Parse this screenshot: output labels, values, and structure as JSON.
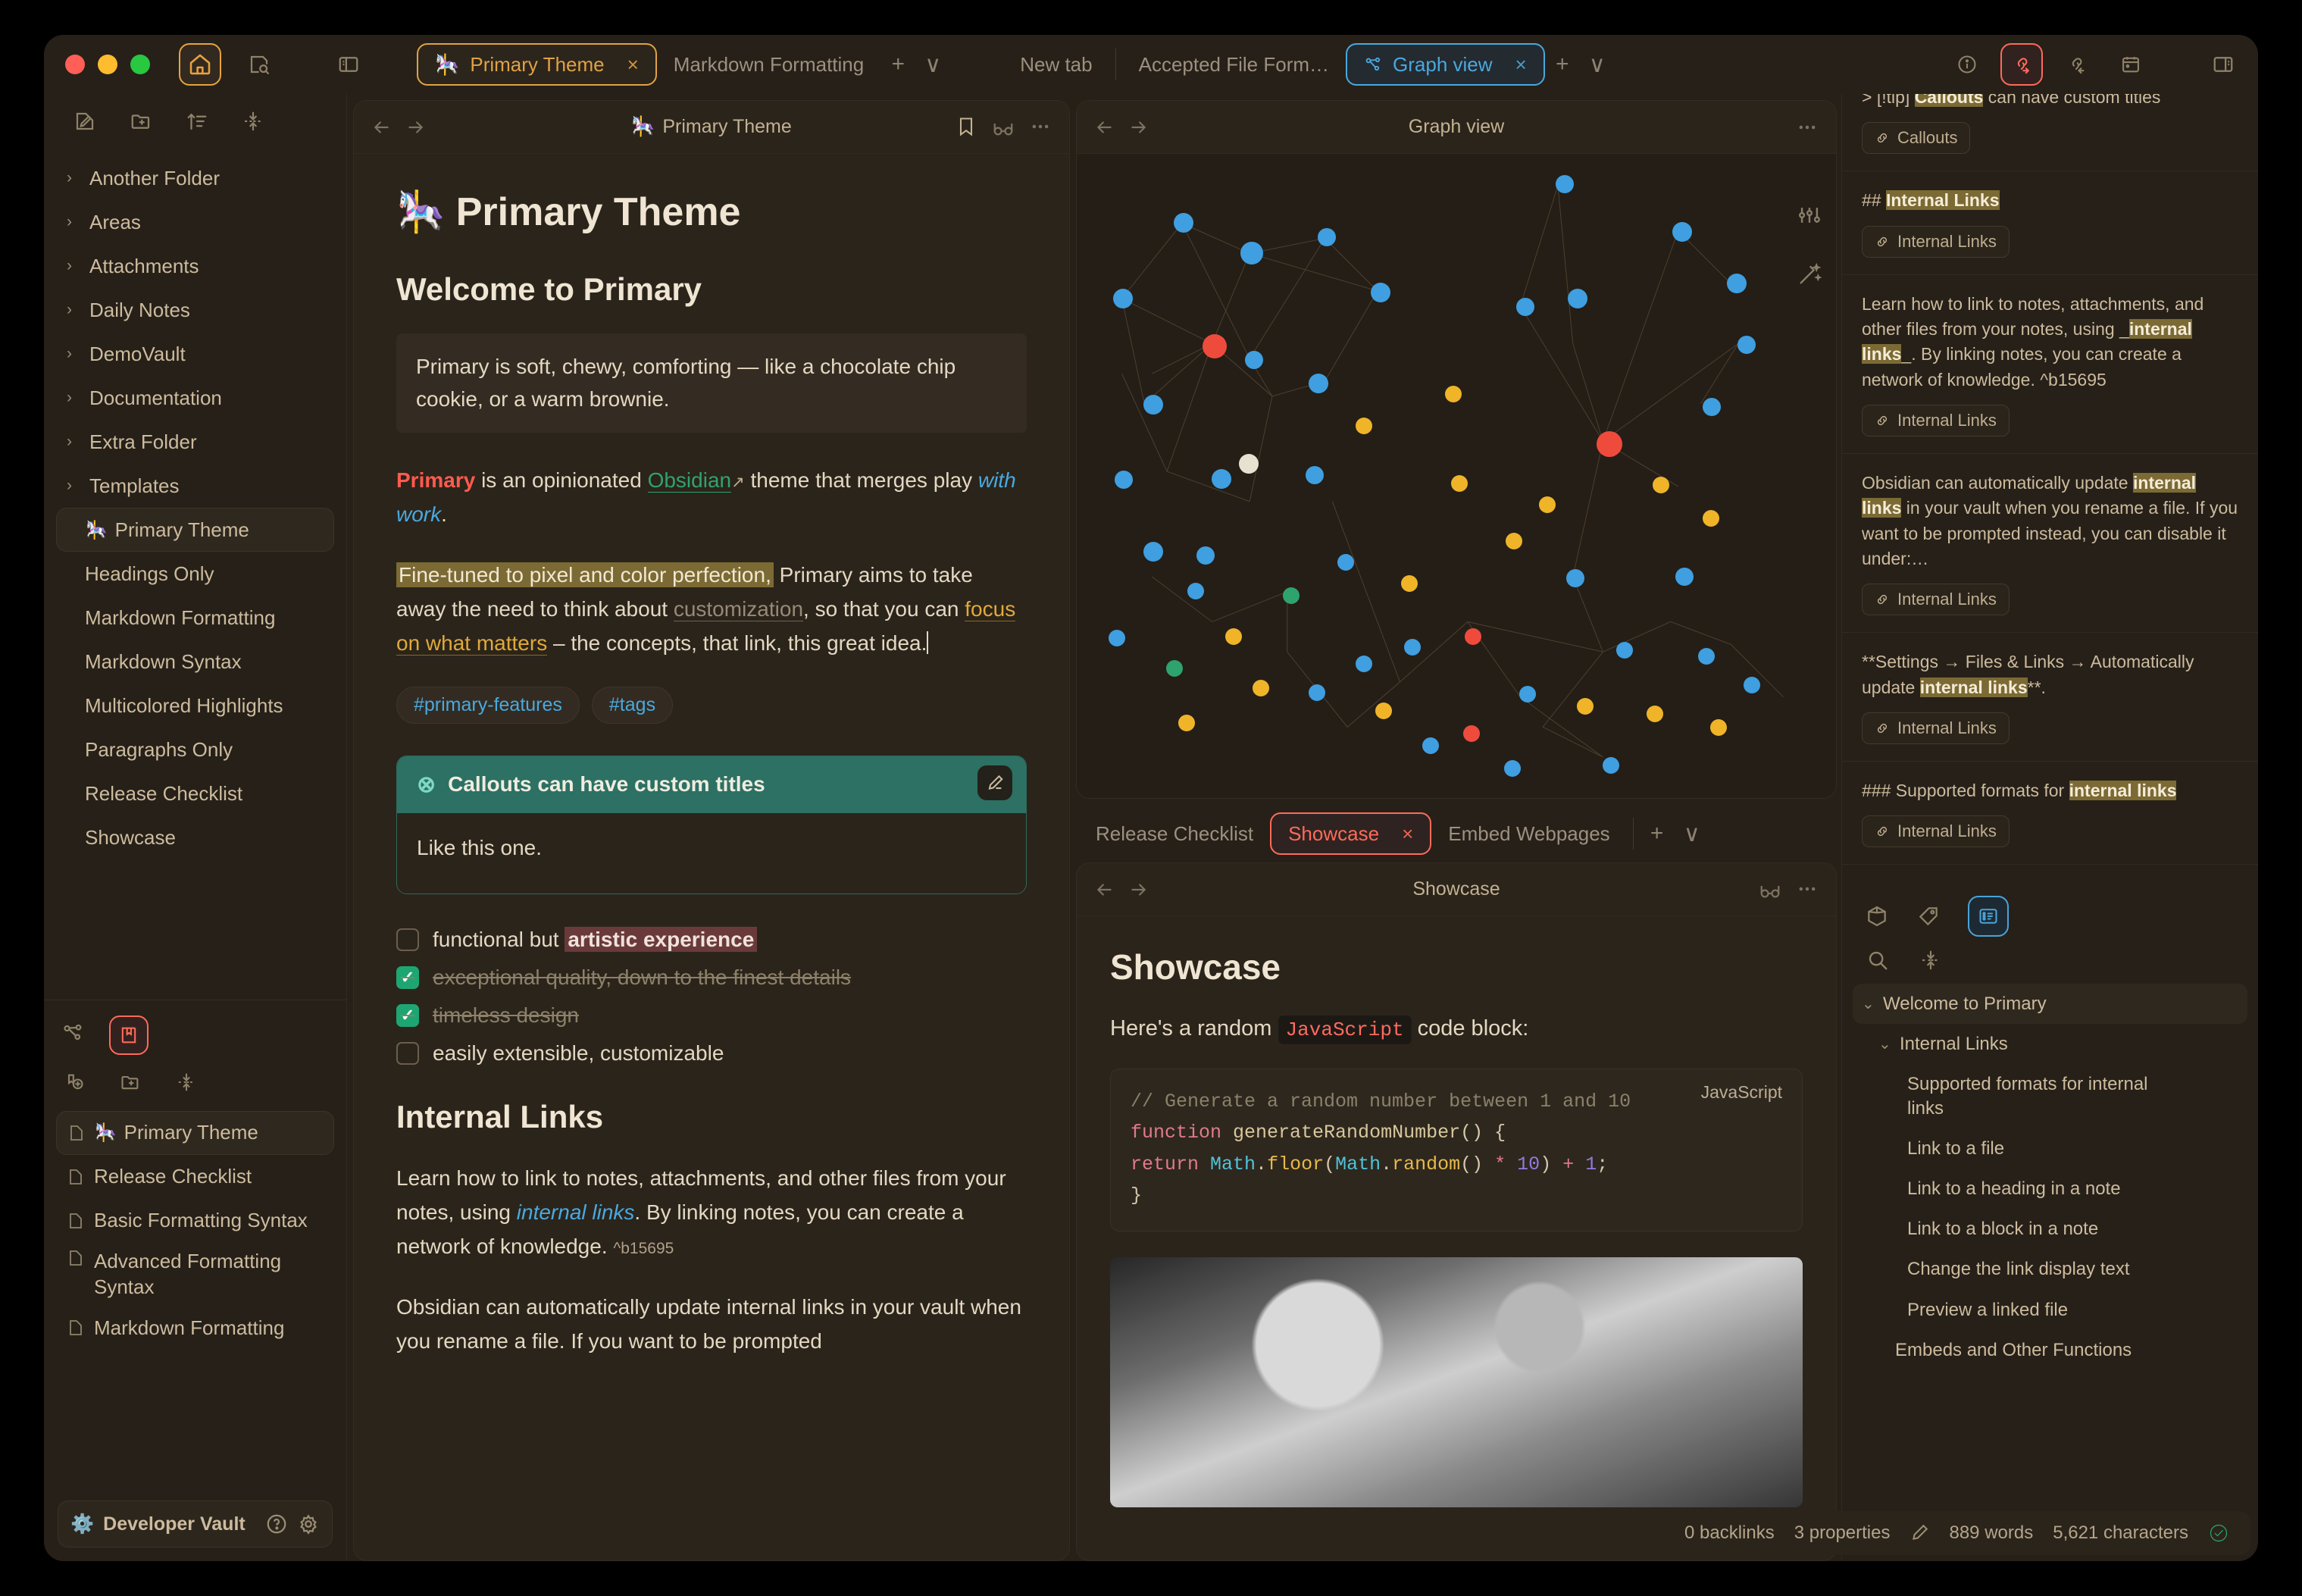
{
  "window": {
    "traffic_lights": [
      "close",
      "minimize",
      "maximize"
    ]
  },
  "toolbar_left": {
    "home_icon": "home-icon",
    "search_note_icon": "note-search-icon",
    "toggle_left_sidebar_icon": "sidebar-left-icon"
  },
  "toolbar_left_secondary": [
    "new-note-icon",
    "new-folder-icon",
    "sort-icon",
    "collapse-icon"
  ],
  "tabs_primary": [
    {
      "emoji": "🎠",
      "label": "Primary Theme",
      "selected": true,
      "accent": "amber",
      "close": "×"
    },
    {
      "label": "Markdown Formatting",
      "selected": false
    }
  ],
  "tabs_primary_controls": {
    "add": "+",
    "more": "∨"
  },
  "tabs_secondary": [
    {
      "label": "New tab",
      "selected": false
    },
    {
      "label": "Accepted File Form…",
      "selected": false
    },
    {
      "icon": "graph-icon",
      "label": "Graph view",
      "selected": true,
      "accent": "blue",
      "close": "×"
    }
  ],
  "tabs_secondary_controls": {
    "add": "+",
    "more": "∨"
  },
  "toolbar_right": [
    "info-icon",
    "outgoing-links-icon",
    "incoming-links-icon",
    "daily-note-icon",
    "toggle-right-sidebar-icon"
  ],
  "sidebar": {
    "folders": [
      {
        "label": "Another Folder"
      },
      {
        "label": "Areas"
      },
      {
        "label": "Attachments"
      },
      {
        "label": "Daily Notes"
      },
      {
        "label": "DemoVault"
      },
      {
        "label": "Documentation"
      },
      {
        "label": "Extra Folder"
      },
      {
        "label": "Templates"
      }
    ],
    "files": [
      {
        "emoji": "🎠",
        "label": "Primary Theme",
        "selected": true
      },
      {
        "label": "Headings Only"
      },
      {
        "label": "Markdown Formatting"
      },
      {
        "label": "Markdown Syntax"
      },
      {
        "label": "Multicolored Highlights"
      },
      {
        "label": "Paragraphs Only"
      },
      {
        "label": "Release Checklist"
      },
      {
        "label": "Showcase"
      }
    ],
    "lower_tabs": [
      "graph-icon",
      "bookmarks-icon"
    ],
    "lower_actions": [
      "new-bookmark-icon",
      "new-folder-icon",
      "collapse-icon"
    ],
    "bookmarks": [
      {
        "emoji": "🎠",
        "label": "Primary Theme",
        "selected": true
      },
      {
        "label": "Release Checklist"
      },
      {
        "label": "Basic Formatting Syntax"
      },
      {
        "label": "Advanced Formatting Syntax"
      },
      {
        "label": "Markdown Formatting"
      }
    ],
    "vault": {
      "emoji": "⚙️",
      "name": "Developer Vault",
      "help": "?",
      "settings": "gear-icon"
    }
  },
  "editor": {
    "header_title": "Primary Theme",
    "header_emoji": "🎠",
    "header_icons": [
      "bookmark-icon",
      "reading-view-icon",
      "more-options-icon"
    ],
    "doc_title": "Primary Theme",
    "doc_emoji": "🎠",
    "h1": "Welcome to Primary",
    "quote": "Primary is soft, chewy, comforting — like a chocolate chip cookie, or a warm brownie.",
    "para1": {
      "bold_red": "Primary",
      "mid": " is an opinionated ",
      "link": "Obsidian",
      "ext_arrow": "↗",
      "tail": " theme that merges play ",
      "italic_blue": "with work",
      "end": "."
    },
    "para2": {
      "highlight": "Fine-tuned to pixel and color perfection,",
      "t1": " Primary aims to take away the need to think about ",
      "grey_link": "customization",
      "t2": ", so that you can ",
      "amber_link": "focus on what matters",
      "t3": " – the concepts, that link, this great idea."
    },
    "tags": [
      "#primary-features",
      "#tags"
    ],
    "callout": {
      "icon": "⊗",
      "title": "Callouts can have custom titles",
      "edit_icon": "pencil-icon",
      "body": "Like this one."
    },
    "tasks": [
      {
        "checked": false,
        "text_before": "functional but ",
        "highlight": "artistic experience"
      },
      {
        "checked": true,
        "text": "exceptional quality, down to the finest details"
      },
      {
        "checked": true,
        "text": "timeless design"
      },
      {
        "checked": false,
        "text": "easily extensible, customizable"
      }
    ],
    "h2": "Internal Links",
    "para3": {
      "t1": "Learn how to link to notes, attachments, and other files from your notes, using ",
      "link": "internal links",
      "t2": ". By linking notes, you can create a network of knowledge. ",
      "blockref": "^b15695"
    },
    "para4": "Obsidian can automatically update internal links in your vault when you rename a file. If you want to be prompted"
  },
  "graph": {
    "title": "Graph view",
    "nav": [
      "back-icon",
      "forward-icon"
    ],
    "more": "more-options-icon",
    "tools": [
      "settings-sliders-icon",
      "restore-layout-icon"
    ],
    "node_colors": {
      "default": "#3f9fe0",
      "red": "#ef4b3c",
      "yellow": "#f0b429",
      "green": "#2fa36d",
      "cream": "#e8e0d0"
    }
  },
  "subtabs": [
    {
      "label": "Release Checklist",
      "selected": false
    },
    {
      "label": "Showcase",
      "selected": true,
      "accent": "red",
      "close": "×"
    },
    {
      "label": "Embed Webpages",
      "selected": false
    }
  ],
  "subtabs_controls": {
    "add": "+",
    "more": "∨"
  },
  "showcase": {
    "header_title": "Showcase",
    "header_icons": [
      "reading-view-icon",
      "more-options-icon"
    ],
    "nav": [
      "back-icon",
      "forward-icon"
    ],
    "title": "Showcase",
    "intro_before": "Here's a random ",
    "intro_code": "JavaScript",
    "intro_after": " code block:",
    "code_lang": "JavaScript",
    "code": {
      "comment": "// Generate a random number between 1 and 10",
      "l2_kw": "function",
      "l2_name": " generateRandomNumber",
      "l2_tail": "() {",
      "l3_kw": "  return ",
      "l3_cls1": "Math",
      "l3_dot1": ".",
      "l3_m1": "floor",
      "l3_p1": "(",
      "l3_cls2": "Math",
      "l3_dot2": ".",
      "l3_m2": "random",
      "l3_p2": "() ",
      "l3_op1": "*",
      "l3_num1": " 10",
      "l3_p3": ") ",
      "l3_op2": "+",
      "l3_num2": " 1",
      "l3_semi": ";",
      "l4": "}"
    }
  },
  "rightbar": {
    "results": [
      {
        "prefix": "> [!tip] ",
        "highlight": "Callouts",
        "suffix": " can have custom titles",
        "chip": "Callouts",
        "partial_top": true
      },
      {
        "prefix": "## ",
        "highlight": "Internal Links",
        "suffix": "",
        "chip": "Internal Links"
      },
      {
        "prefix": "Learn how to link to notes, attachments, and other files from your notes, using _",
        "highlight": "internal links",
        "suffix": "_. By linking notes, you can create a network of knowledge. ^b15695",
        "chip": "Internal Links"
      },
      {
        "prefix": "Obsidian can automatically update ",
        "highlight": "internal links",
        "suffix": " in your vault when you rename a file. If you want to be prompted instead, you can disable it under:…",
        "chip": "Internal Links"
      },
      {
        "prefix": "**Settings → Files & Links → Automatically update ",
        "highlight": "internal links",
        "suffix": "**.",
        "chip": "Internal Links"
      },
      {
        "prefix": "### Supported formats for ",
        "highlight": "internal links",
        "suffix": "",
        "chip": "Internal Links"
      }
    ],
    "panel_tabs": [
      "properties-icon",
      "tags-icon",
      "outline-icon"
    ],
    "panel_actions": [
      "search-icon",
      "collapse-icon"
    ],
    "outline": [
      {
        "label": "Welcome to Primary",
        "level": 0,
        "chevron": "⌄",
        "selected": true
      },
      {
        "label": "Internal Links",
        "level": 1,
        "chevron": "⌄"
      },
      {
        "label": "Supported formats for internal links",
        "level": 2
      },
      {
        "label": "Link to a file",
        "level": 2
      },
      {
        "label": "Link to a heading in a note",
        "level": 2
      },
      {
        "label": "Link to a block in a note",
        "level": 2
      },
      {
        "label": "Change the link display text",
        "level": 2
      },
      {
        "label": "Preview a linked file",
        "level": 2
      },
      {
        "label": "Embeds and Other Functions",
        "level": 3
      }
    ]
  },
  "statusbar": {
    "backlinks": "0 backlinks",
    "properties": "3 properties",
    "edit_icon": "pencil-icon",
    "words": "889 words",
    "characters": "5,621 characters",
    "sync_icon": "check-circle-icon"
  }
}
